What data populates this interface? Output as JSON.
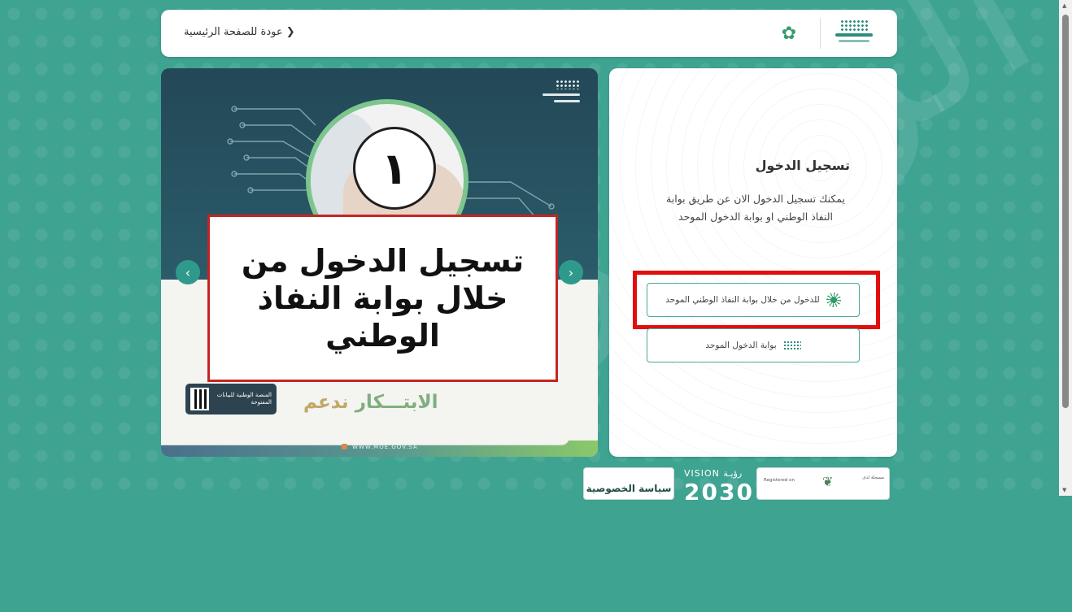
{
  "header": {
    "back_link": "عودة للصفحة الرئيسية ❯"
  },
  "slider": {
    "step_number": "١",
    "callout_text": "تسجيل الدخول من خلال بوابة النفاذ الوطني",
    "support_word1": "ندعم",
    "support_word2": "الابتـــكار",
    "qr_text": "المنصة الوطنية للبيانات المفتوحة",
    "url": "WWW.MOE.GOV.SA",
    "prev_icon": "‹",
    "next_icon": "›"
  },
  "login": {
    "title": "تسجيل الدخول",
    "description": "يمكنك تسجيل الدخول الان عن طريق بوابة النفاذ الوطني او بوابة الدخول الموحد",
    "nafath_button": "للدخول من خلال بوابة النفاذ الوطني الموحد",
    "unified_button": "بوابة الدخول الموحد"
  },
  "footer": {
    "privacy": "سياسة الخصوصية",
    "vision_line1": "VISION رؤيـة",
    "vision_line2": "2030",
    "registered_on": "Registered on",
    "registered_ar": "مسجلة لدى"
  }
}
